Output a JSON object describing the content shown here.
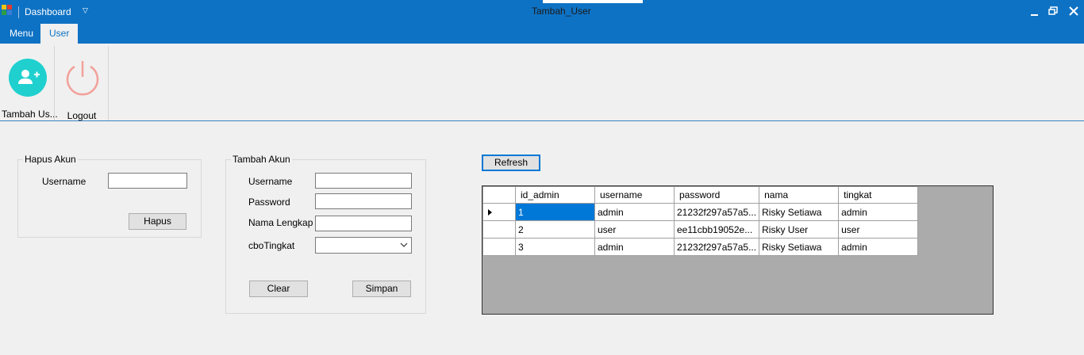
{
  "titlebar": {
    "quick_access_title": "Dashboard",
    "window_title": "Tambah_User"
  },
  "tabs": [
    {
      "label": "Menu"
    },
    {
      "label": "User"
    }
  ],
  "ribbon": {
    "tambah_user_label": "Tambah Us...",
    "logout_label": "Logout"
  },
  "hapus_akun": {
    "legend": "Hapus Akun",
    "username_label": "Username",
    "username_value": "",
    "hapus_button": "Hapus"
  },
  "tambah_akun": {
    "legend": "Tambah Akun",
    "username_label": "Username",
    "password_label": "Password",
    "nama_label": "Nama Lengkap",
    "tingkat_label": "cboTingkat",
    "clear_button": "Clear",
    "simpan_button": "Simpan"
  },
  "refresh_button": "Refresh",
  "grid": {
    "columns": [
      "id_admin",
      "username",
      "password",
      "nama",
      "tingkat"
    ],
    "rows": [
      [
        "1",
        "admin",
        "21232f297a57a5...",
        "Risky Setiawa",
        "admin"
      ],
      [
        "2",
        "user",
        "ee11cbb19052e...",
        "Risky User",
        "user"
      ],
      [
        "3",
        "admin",
        "21232f297a57a5...",
        "Risky Setiawa",
        "admin"
      ]
    ],
    "selected_row": 0
  },
  "colors": {
    "accent": "#0e72c4",
    "selection": "#0078d7"
  }
}
